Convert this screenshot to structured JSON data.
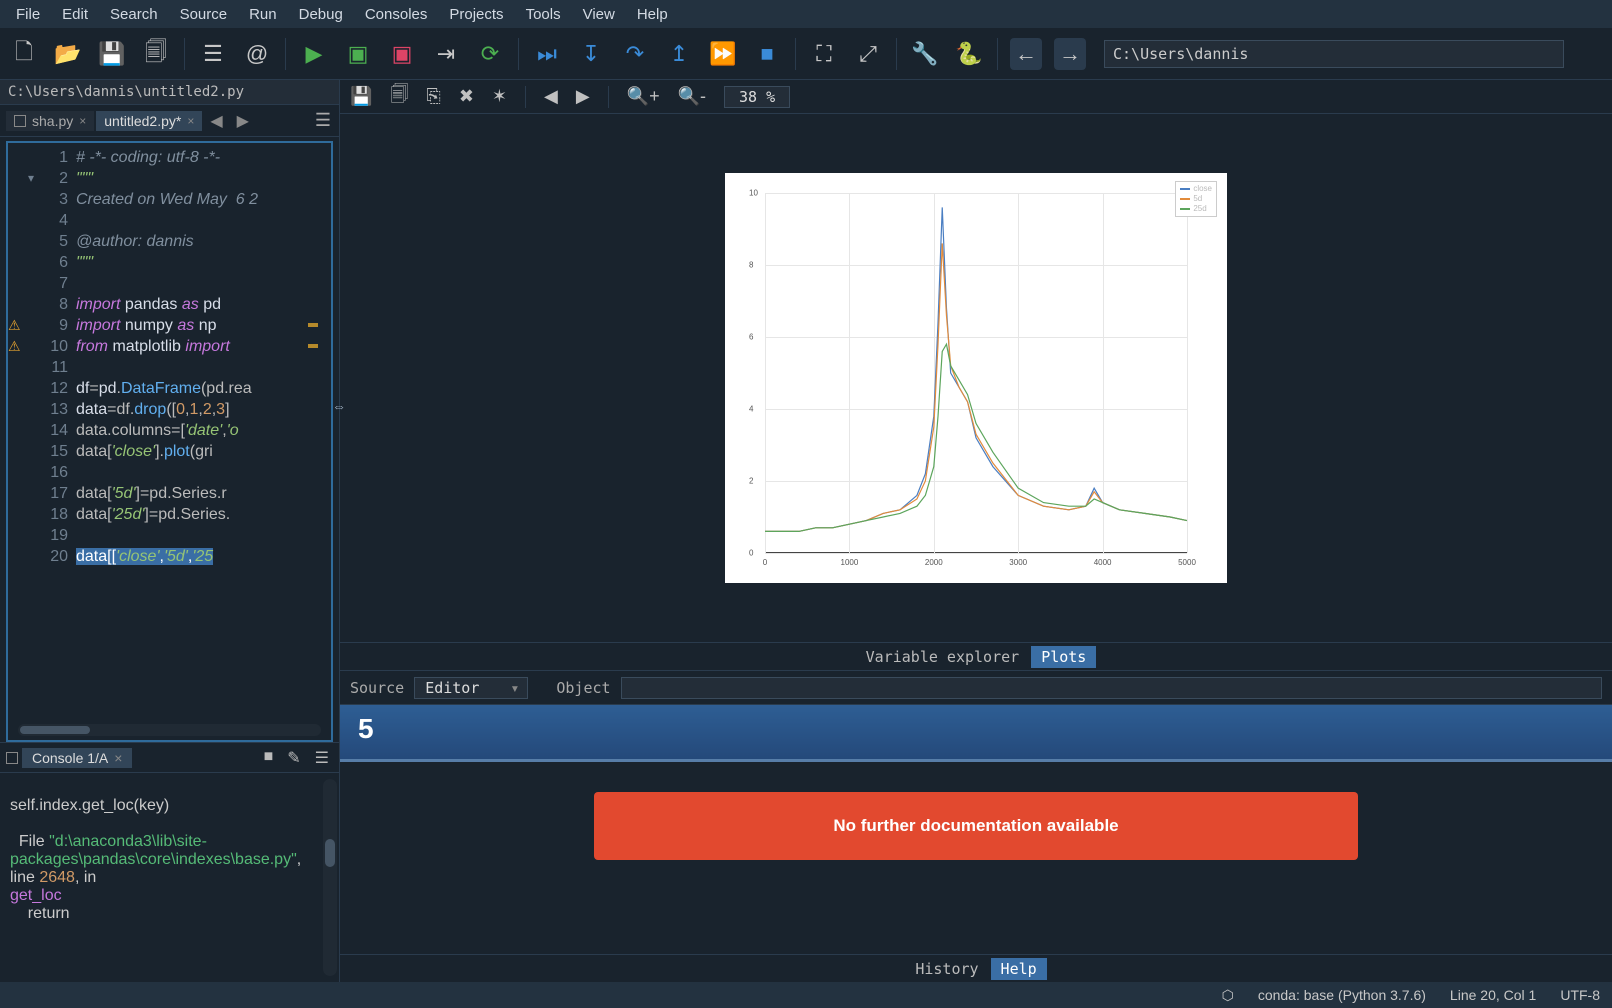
{
  "menu": {
    "items": [
      "File",
      "Edit",
      "Search",
      "Source",
      "Run",
      "Debug",
      "Consoles",
      "Projects",
      "Tools",
      "View",
      "Help"
    ]
  },
  "toolbar": {
    "path_value": "C:\\Users\\dannis"
  },
  "editor": {
    "path_bar": "C:\\Users\\dannis\\untitled2.py",
    "tabs": [
      {
        "label": "sha.py",
        "active": false
      },
      {
        "label": "untitled2.py*",
        "active": true
      }
    ],
    "lines": [
      {
        "n": 1,
        "cls": "",
        "html": "<span class='tok-cm'># -*- coding: utf-8 -*-</span>"
      },
      {
        "n": 2,
        "cls": "fold",
        "html": "<span class='tok-str'>\"\"\"</span>"
      },
      {
        "n": 3,
        "cls": "",
        "html": "<span class='tok-cm'>Created on Wed May  6 2</span>"
      },
      {
        "n": 4,
        "cls": "",
        "html": ""
      },
      {
        "n": 5,
        "cls": "",
        "html": "<span class='tok-cm'>@author: dannis</span>"
      },
      {
        "n": 6,
        "cls": "",
        "html": "<span class='tok-str'>\"\"\"</span>"
      },
      {
        "n": 7,
        "cls": "",
        "html": ""
      },
      {
        "n": 8,
        "cls": "",
        "html": "<span class='tok-kw'>import</span> <span class='tok-mod'>pandas</span> <span class='tok-kw'>as</span> <span class='tok-mod'>pd</span>"
      },
      {
        "n": 9,
        "cls": "warn mark",
        "html": "<span class='tok-kw'>import</span> <span class='tok-mod'>numpy</span> <span class='tok-kw'>as</span> <span class='tok-mod'>np</span>"
      },
      {
        "n": 10,
        "cls": "warn mark",
        "html": "<span class='tok-kw'>from</span> <span class='tok-mod'>matplotlib</span> <span class='tok-kw'>import</span> "
      },
      {
        "n": 11,
        "cls": "",
        "html": ""
      },
      {
        "n": 12,
        "cls": "",
        "html": "<span class='tok-var'>df</span>=<span class='tok-var'>pd</span>.<span class='tok-fn'>DataFrame</span>(pd.rea"
      },
      {
        "n": 13,
        "cls": "",
        "html": "<span class='tok-var'>data</span>=df.<span class='tok-fn'>drop</span>([<span class='tok-num'>0</span>,<span class='tok-num'>1</span>,<span class='tok-num'>2</span>,<span class='tok-num'>3</span>]"
      },
      {
        "n": 14,
        "cls": "",
        "html": "data.columns=[<span class='tok-str'>'date'</span>,<span class='tok-str'>'o</span>"
      },
      {
        "n": 15,
        "cls": "",
        "html": "data[<span class='tok-str'>'close'</span>].<span class='tok-fn'>plot</span>(gri"
      },
      {
        "n": 16,
        "cls": "",
        "html": ""
      },
      {
        "n": 17,
        "cls": "",
        "html": "data[<span class='tok-str'>'5d'</span>]=pd.Series.r"
      },
      {
        "n": 18,
        "cls": "",
        "html": "data[<span class='tok-str'>'25d'</span>]=pd.Series."
      },
      {
        "n": 19,
        "cls": "",
        "html": ""
      },
      {
        "n": 20,
        "cls": "",
        "html": "<span class='sel'>data[[<span class='tok-str'>'close'</span>,<span class='tok-str'>'5d'</span>,<span class='tok-str'>'25</span></span>"
      }
    ]
  },
  "console": {
    "tab_label": "Console 1/A",
    "trace_line1": "self.index.get_loc(key)",
    "trace_file_kw": "File",
    "trace_path": "\"d:\\anaconda3\\lib\\site-packages\\pandas\\core\\indexes\\base.py\"",
    "trace_line_kw": ", line ",
    "trace_lineno": "2648",
    "trace_in": ", in",
    "trace_fn": "get_loc",
    "trace_ret": "return"
  },
  "plot": {
    "zoom_label": "38 %",
    "tabs": {
      "var": "Variable explorer",
      "plots": "Plots"
    }
  },
  "help": {
    "source_label": "Source",
    "source_value": "Editor",
    "object_label": "Object",
    "title": "5",
    "alert": "No further documentation available",
    "tabs": {
      "history": "History",
      "help": "Help"
    }
  },
  "status": {
    "env": "conda: base (Python 3.7.6)",
    "pos": "Line 20, Col 1",
    "enc": "UTF-8"
  },
  "chart_data": {
    "type": "line",
    "title": "",
    "xlabel": "",
    "ylabel": "",
    "x_ticks": [
      0,
      1000,
      2000,
      3000,
      4000,
      5000
    ],
    "y_ticks": [
      0,
      2,
      4,
      6,
      8,
      10
    ],
    "xlim": [
      0,
      5000
    ],
    "ylim": [
      0,
      10
    ],
    "legend_pos": "upper-right",
    "legend": [
      "close",
      "5d",
      "25d"
    ],
    "colors": [
      "#4a7ec2",
      "#e28b3b",
      "#5ca55c"
    ],
    "x": [
      0,
      200,
      400,
      600,
      800,
      1000,
      1200,
      1400,
      1600,
      1800,
      1900,
      2000,
      2050,
      2100,
      2150,
      2200,
      2300,
      2400,
      2500,
      2700,
      3000,
      3300,
      3600,
      3800,
      3900,
      4000,
      4200,
      4500,
      4800,
      5000
    ],
    "series": [
      {
        "name": "close",
        "values": [
          0.6,
          0.6,
          0.6,
          0.7,
          0.7,
          0.8,
          0.9,
          1.1,
          1.2,
          1.6,
          2.2,
          3.8,
          6.4,
          9.6,
          6.8,
          5.0,
          4.6,
          4.2,
          3.2,
          2.4,
          1.6,
          1.3,
          1.2,
          1.3,
          1.8,
          1.4,
          1.2,
          1.1,
          1.0,
          0.9
        ]
      },
      {
        "name": "5d",
        "values": [
          0.6,
          0.6,
          0.6,
          0.7,
          0.7,
          0.8,
          0.9,
          1.1,
          1.2,
          1.5,
          2.0,
          3.5,
          5.8,
          8.6,
          6.6,
          5.2,
          4.6,
          4.2,
          3.3,
          2.5,
          1.6,
          1.3,
          1.2,
          1.3,
          1.7,
          1.4,
          1.2,
          1.1,
          1.0,
          0.9
        ]
      },
      {
        "name": "25d",
        "values": [
          0.6,
          0.6,
          0.6,
          0.7,
          0.7,
          0.8,
          0.9,
          1.0,
          1.1,
          1.3,
          1.6,
          2.4,
          3.8,
          5.6,
          5.8,
          5.2,
          4.8,
          4.4,
          3.6,
          2.8,
          1.8,
          1.4,
          1.3,
          1.3,
          1.5,
          1.4,
          1.2,
          1.1,
          1.0,
          0.9
        ]
      }
    ]
  }
}
